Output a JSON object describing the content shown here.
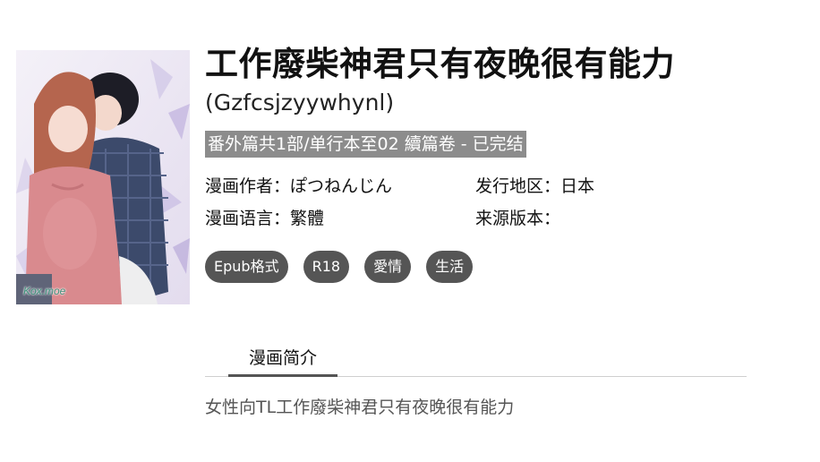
{
  "cover": {
    "watermark": "Kox.moe"
  },
  "book": {
    "title": "工作廢柴神君只有夜晚很有能力",
    "subtitle": "(Gzfcsjzyywhynl)",
    "status_line": "番外篇共1部/单行本至02 續篇卷 - 已完结"
  },
  "meta": {
    "author_label": "漫画作者：",
    "author_value": "ぽつねんじん",
    "region_label": "发行地区：",
    "region_value": "日本",
    "language_label": "漫画语言：",
    "language_value": "繁體",
    "source_label": "来源版本：",
    "source_value": ""
  },
  "tags": [
    "Epub格式",
    "R18",
    "愛情",
    "生活"
  ],
  "tabs": {
    "active_label": "漫画简介"
  },
  "description": "女性向TL工作廢柴神君只有夜晚很有能力",
  "colors": {
    "status_bg": "#8c8c8c",
    "tag_bg": "#555555",
    "tab_underline": "#555555",
    "description_text": "#555555"
  }
}
